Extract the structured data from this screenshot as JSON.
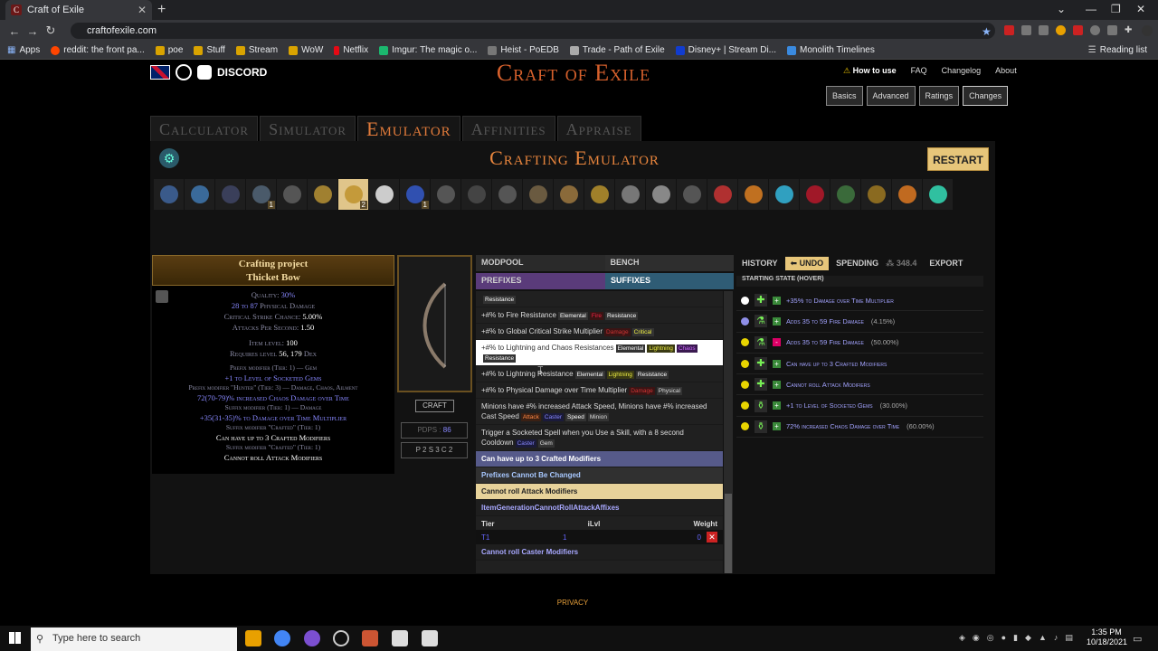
{
  "browser": {
    "tab_title": "Craft of Exile",
    "url": "craftofexile.com",
    "bookmarks": [
      "Apps",
      "reddit: the front pa...",
      "poe",
      "Stuff",
      "Stream",
      "WoW",
      "Netflix",
      "Imgur: The magic o...",
      "Heist - PoEDB",
      "Trade - Path of Exile",
      "Disney+ | Stream Di...",
      "Monolith Timelines"
    ],
    "reading_list": "Reading list"
  },
  "site": {
    "logo": "Craft of Exile",
    "discord": "DISCORD",
    "links": [
      "How to use",
      "FAQ",
      "Changelog",
      "About"
    ],
    "buttons": [
      "Basics",
      "Advanced",
      "Ratings",
      "Changes"
    ],
    "modes": [
      "Calculator",
      "Simulator",
      "Emulator",
      "Affinities",
      "Appraise"
    ],
    "title": "Crafting Emulator",
    "restart": "RESTART",
    "privacy": "PRIVACY"
  },
  "orbs": [
    {
      "color": "#3a5a8a"
    },
    {
      "color": "#3a6a9a"
    },
    {
      "color": "#3a3f5a"
    },
    {
      "color": "#4a5a6a",
      "count": "1"
    },
    {
      "color": "#555"
    },
    {
      "color": "#a08030"
    },
    {
      "color": "#c49a3a",
      "count": "2",
      "selected": true
    },
    {
      "color": "#ccc"
    },
    {
      "color": "#3050b0",
      "count": "1"
    },
    {
      "color": "#555"
    },
    {
      "color": "#444"
    },
    {
      "color": "#555"
    },
    {
      "color": "#6a5a40"
    },
    {
      "color": "#8a6a3a"
    },
    {
      "color": "#a0802a"
    },
    {
      "color": "#777"
    },
    {
      "color": "#888"
    },
    {
      "color": "#555"
    },
    {
      "color": "#b03030"
    },
    {
      "color": "#c07020"
    },
    {
      "color": "#30a0c0"
    },
    {
      "color": "#a01828"
    },
    {
      "color": "#3a6a3a"
    },
    {
      "color": "#8a6a20"
    },
    {
      "color": "#c06a20"
    },
    {
      "color": "#30c0a0"
    }
  ],
  "item": {
    "hdr1": "Crafting project",
    "hdr2": "Thicket Bow",
    "props": [
      {
        "pre": "Quality: ",
        "val": "30%",
        "cls": "m"
      },
      {
        "pre": "",
        "val": "28 to 87",
        "post": " Physical Damage",
        "cls": "m"
      },
      {
        "pre": "Critical Strike Chance: ",
        "val": "5.00%",
        "cls": "w"
      },
      {
        "pre": "Attacks Per Second: ",
        "val": "1.50",
        "cls": "w"
      }
    ],
    "level": [
      {
        "pre": "Item level: ",
        "val": "100"
      },
      {
        "pre": "Requires level ",
        "val": "56, 179",
        "post": " Dex"
      }
    ],
    "mods": [
      {
        "h": "Prefix modifier (Tier: 1) — Gem",
        "t": "+1 to Level of Socketed Gems",
        "c": "m"
      },
      {
        "h": "Prefix modifier \"Hunter\" (Tier: 3) — Damage, Chaos, Ailment",
        "t": "72(70-79)% increased Chaos Damage over Time",
        "c": "m"
      },
      {
        "h": "Suffix modifier (Tier: 1) — Damage",
        "t": "+35(31-35)% to Damage over Time Multiplier",
        "c": "m"
      },
      {
        "h": "Suffix modifier \"Crafted\" (Tier: 1)",
        "t": "Can have up to 3 Crafted Modifiers",
        "c": "w"
      },
      {
        "h": "Suffix modifier \"Crafted\" (Tier: 1)",
        "t": "Cannot roll Attack Modifiers",
        "c": "w"
      }
    ],
    "craft": "CRAFT",
    "dps_label": "PDPS : ",
    "dps_val": "86",
    "sockets": "P 2  S 3  C 2"
  },
  "modpool": {
    "tabs": [
      "MODPOOL",
      "BENCH"
    ],
    "prefixes": "PREFIXES",
    "suffixes": "SUFFIXES",
    "rows": [
      {
        "text": "",
        "tags": [
          {
            "t": "Resistance",
            "c": "tg-res"
          }
        ]
      },
      {
        "text": "+#% to Fire Resistance",
        "tags": [
          {
            "t": "Elemental",
            "c": "tg-el"
          },
          {
            "t": "Fire",
            "c": "tg-fire"
          },
          {
            "t": "Resistance",
            "c": "tg-res"
          }
        ]
      },
      {
        "text": "+#% to Global Critical Strike Multiplier",
        "tags": [
          {
            "t": "Damage",
            "c": "tg-dmg"
          },
          {
            "t": "Critical",
            "c": "tg-crit"
          }
        ]
      },
      {
        "text": "+#% to Lightning and Chaos Resistances",
        "hl": true,
        "tags": [
          {
            "t": "Elemental",
            "c": "tg-el"
          },
          {
            "t": "Lightning",
            "c": "tg-lig"
          },
          {
            "t": "Chaos",
            "c": "tg-cha"
          },
          {
            "t": "Resistance",
            "c": "tg-res"
          }
        ]
      },
      {
        "text": "+#% to Lightning Resistance",
        "tags": [
          {
            "t": "Elemental",
            "c": "tg-el"
          },
          {
            "t": "Lightning",
            "c": "tg-lig"
          },
          {
            "t": "Resistance",
            "c": "tg-res"
          }
        ]
      },
      {
        "text": "+#% to Physical Damage over Time Multiplier",
        "tags": [
          {
            "t": "Damage",
            "c": "tg-dmg"
          },
          {
            "t": "Physical",
            "c": "tg-phy"
          }
        ]
      },
      {
        "text": "Minions have #% increased Attack Speed, Minions have #% increased Cast Speed",
        "tags": [
          {
            "t": "Attack",
            "c": "tg-atk"
          },
          {
            "t": "Caster",
            "c": "tg-cas"
          },
          {
            "t": "Speed",
            "c": "tg-spd"
          },
          {
            "t": "Minion",
            "c": "tg-min"
          }
        ]
      },
      {
        "text": "Trigger a Socketed Spell when you Use a Skill, with a 8 second Cooldown",
        "tags": [
          {
            "t": "Caster",
            "c": "tg-cas"
          },
          {
            "t": "Gem",
            "c": "tg-gem"
          }
        ]
      }
    ],
    "groups": [
      "Can have up to 3 Crafted Modifiers",
      "Prefixes Cannot Be Changed",
      "Cannot roll Attack Modifiers",
      "ItemGenerationCannotRollAttackAffixes"
    ],
    "tier_head": [
      "Tier",
      "iLvl",
      "Weight"
    ],
    "tier_row": [
      "T1",
      "1",
      "0"
    ],
    "last_group": "Cannot roll Caster Modifiers"
  },
  "history": {
    "tabs": [
      "HISTORY",
      "UNDO",
      "SPENDING",
      "348.4",
      "EXPORT"
    ],
    "starting": "STARTING STATE (HOVER)",
    "rows": [
      {
        "dot": "wh",
        "sign": "+",
        "text": "+35% to Damage over Time Multiplier",
        "pct": ""
      },
      {
        "dot": "pu",
        "sign": "+",
        "text": "Adds 35 to 59 Fire Damage",
        "pct": "(4.15%)"
      },
      {
        "dot": "",
        "sign": "-",
        "text": "Adds 35 to 59 Fire Damage",
        "pct": "(50.00%)"
      },
      {
        "dot": "",
        "sign": "+",
        "text": "Can have up to 3 Crafted Modifiers",
        "pct": ""
      },
      {
        "dot": "",
        "sign": "+",
        "text": "Cannot roll Attack Modifiers",
        "pct": ""
      },
      {
        "dot": "",
        "sign": "+",
        "text": "+1 to Level of Socketed Gems",
        "pct": "(30.00%)"
      },
      {
        "dot": "",
        "sign": "+",
        "text": "72% increased Chaos Damage over Time",
        "pct": "(60.00%)"
      }
    ]
  },
  "taskbar": {
    "search": "Type here to search",
    "time": "1:35 PM",
    "date": "10/18/2021"
  }
}
